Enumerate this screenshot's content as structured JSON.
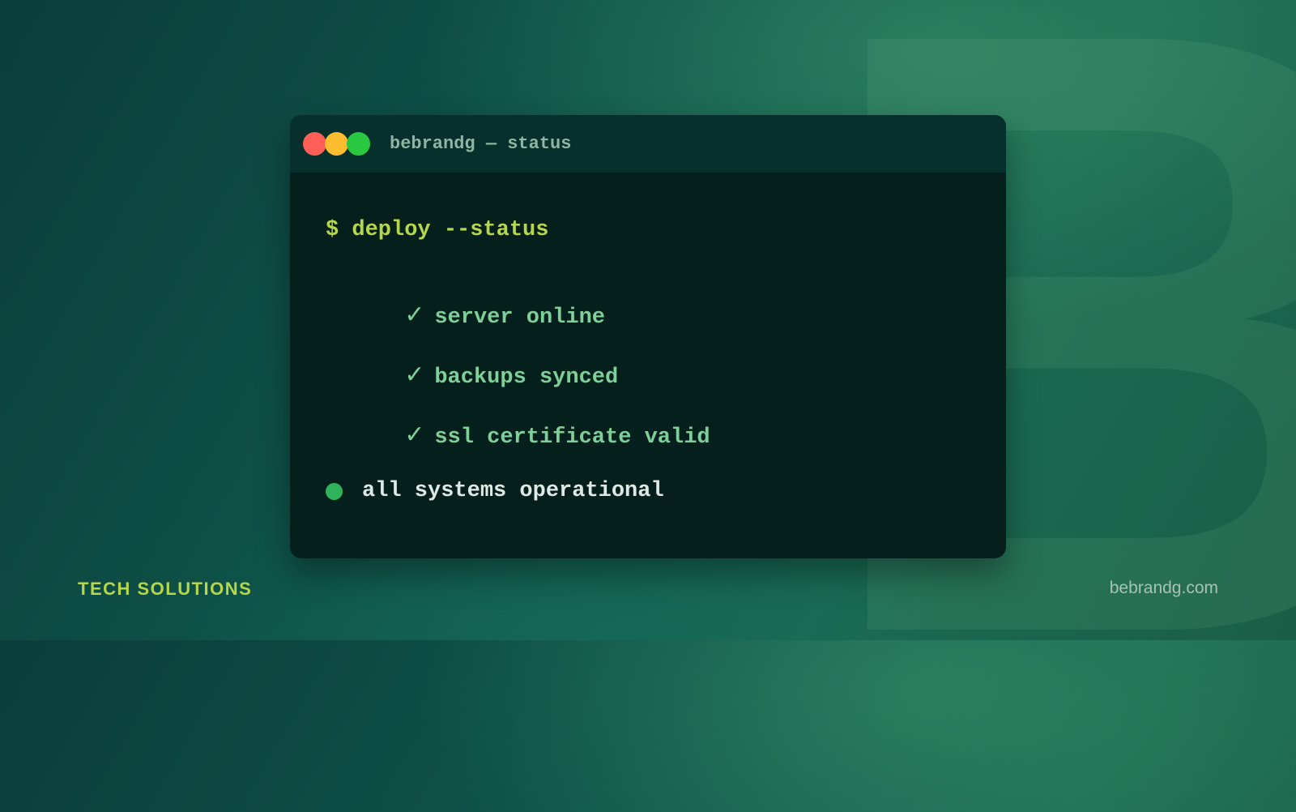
{
  "background": {
    "letter": "B"
  },
  "terminal": {
    "title": "bebrandg — status",
    "prompt": "$ deploy --status",
    "checks": [
      {
        "icon": "✓",
        "text": "server online"
      },
      {
        "icon": "✓",
        "text": "backups synced"
      },
      {
        "icon": "✓",
        "text": "ssl certificate valid"
      }
    ],
    "status_text": "all systems operational"
  },
  "footer": {
    "tagline": "TECH SOLUTIONS",
    "website": "bebrandg.com"
  },
  "colors": {
    "accent": "#b7d64a",
    "check_green": "#7fcf99",
    "status_dot": "#2fb35a",
    "dot_red": "#ff5f57",
    "dot_yellow": "#febc2e",
    "dot_green": "#28c840"
  }
}
